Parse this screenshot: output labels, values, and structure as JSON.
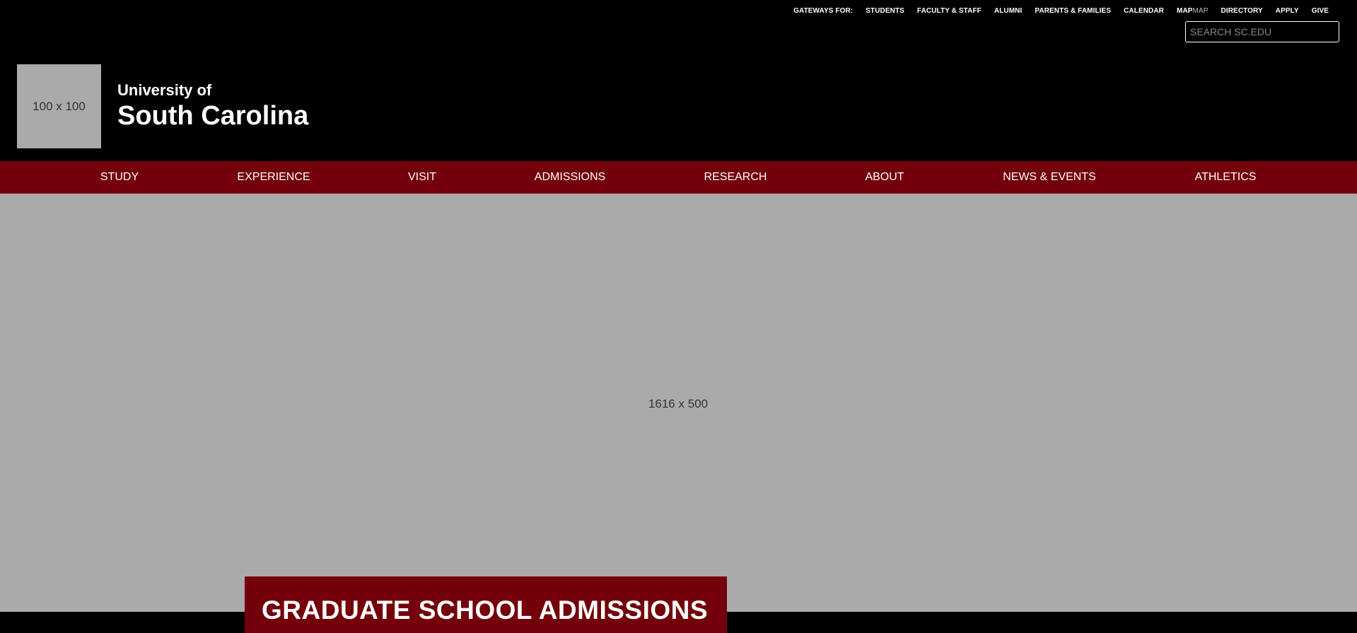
{
  "utility": {
    "gateways_label": "GATEWAYS FOR:",
    "links": [
      "STUDENTS",
      "FACULTY & STAFF",
      "ALUMNI",
      "PARENTS & FAMILIES",
      "CALENDAR"
    ],
    "map_label": "MAP",
    "map_duplicate": "MAP",
    "links_after": [
      "DIRECTORY",
      "APPLY",
      "GIVE"
    ],
    "search_placeholder": "SEARCH SC.EDU"
  },
  "brand": {
    "logo_placeholder": "100 x 100",
    "line1": "University of",
    "line2": "South Carolina"
  },
  "nav": [
    "STUDY",
    "EXPERIENCE",
    "VISIT",
    "ADMISSIONS",
    "RESEARCH",
    "ABOUT",
    "NEWS & EVENTS",
    "ATHLETICS"
  ],
  "hero": {
    "image_placeholder": "1616 x 500",
    "callout_title": "GRADUATE SCHOOL ADMISSIONS"
  },
  "colors": {
    "garnet": "#73000a",
    "black": "#000000",
    "placeholder_gray": "#aaaaaa"
  }
}
